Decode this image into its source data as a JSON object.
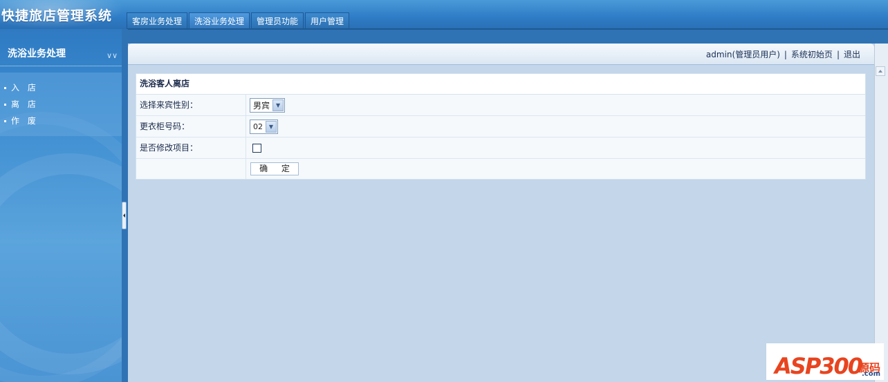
{
  "app": {
    "title": "快捷旅店管理系统"
  },
  "tabs": [
    {
      "label": "客房业务处理"
    },
    {
      "label": "洗浴业务处理"
    },
    {
      "label": "管理员功能"
    },
    {
      "label": "用户管理"
    }
  ],
  "sidebar": {
    "title": "洗浴业务处理",
    "items": [
      {
        "label": "入 店"
      },
      {
        "label": "离 店"
      },
      {
        "label": "作 废"
      }
    ]
  },
  "header": {
    "user": "admin(管理员用户)",
    "home_link": "系统初始页",
    "logout_link": "退出"
  },
  "form": {
    "title": "洗浴客人离店",
    "gender_label": "选择来宾性别：",
    "gender_value": "男宾",
    "locker_label": "更衣柜号码：",
    "locker_value": "02",
    "modify_label": "是否修改项目：",
    "modify_checked": false,
    "submit_label": "确 定"
  },
  "watermark": {
    "brand": "ASP300",
    "sub": "源码",
    "domain": ".com"
  }
}
